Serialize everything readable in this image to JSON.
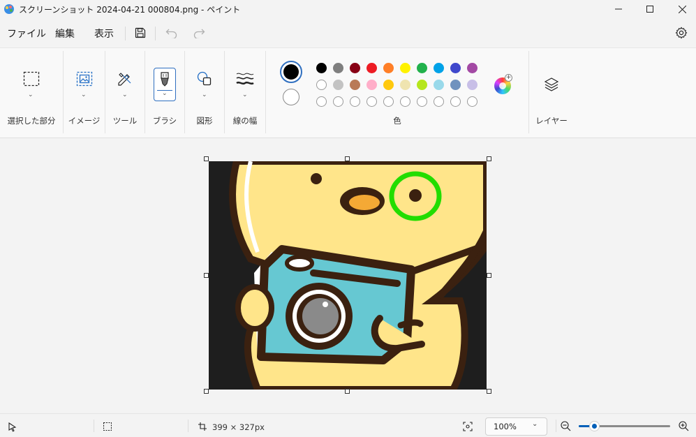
{
  "window": {
    "title": "スクリーンショット 2024-04-21 000804.png - ペイント"
  },
  "menu": {
    "file": "ファイル",
    "edit": "編集",
    "view": "表示"
  },
  "ribbon": {
    "groups": {
      "selection": "選択した部分",
      "image": "イメージ",
      "tools": "ツール",
      "brush": "ブラシ",
      "shapes": "図形",
      "line_width": "線の幅",
      "colors": "色",
      "layers": "レイヤー"
    },
    "primary_color": "#000000",
    "secondary_color": "#ffffff",
    "palette_row1": [
      "#000000",
      "#7f7f7f",
      "#880015",
      "#ed1c24",
      "#ff7f27",
      "#fff200",
      "#22b14c",
      "#00a2e8",
      "#3f48cc",
      "#a349a4"
    ],
    "palette_row2": [
      "#ffffff",
      "#c3c3c3",
      "#b97a57",
      "#ffaec9",
      "#ffc90e",
      "#efe4b0",
      "#b5e61d",
      "#99d9ea",
      "#7092be",
      "#c8bfe7"
    ],
    "palette_row3_empty": 10
  },
  "canvas": {
    "background": "#1e1e1e"
  },
  "status": {
    "size": "399 × 327px",
    "zoom": "100%"
  }
}
